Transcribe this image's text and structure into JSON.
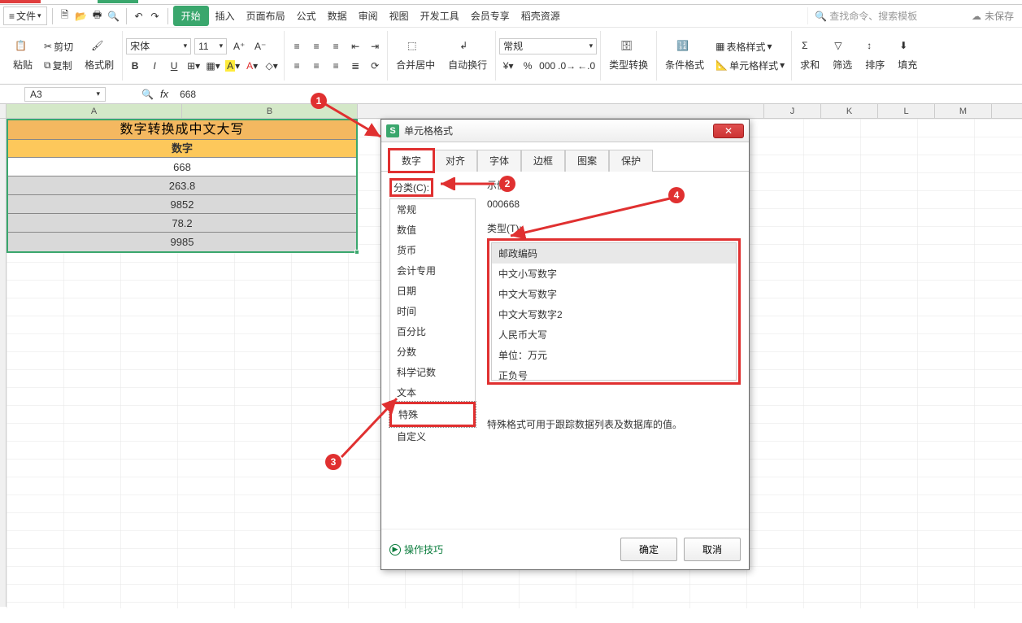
{
  "tabs": {
    "file": "文件"
  },
  "menu": {
    "start": "开始",
    "insert": "插入",
    "page": "页面布局",
    "formula": "公式",
    "data": "数据",
    "review": "审阅",
    "view": "视图",
    "dev": "开发工具",
    "vip": "会员专享",
    "daoke": "稻壳资源",
    "search_placeholder": "查找命令、搜索模板",
    "unsaved": "未保存"
  },
  "ribbon": {
    "cut": "剪切",
    "copy": "复制",
    "fmt_painter": "格式刷",
    "paste": "粘贴",
    "font_name": "宋体",
    "font_size": "11",
    "merge": "合并居中",
    "wrap": "自动换行",
    "general": "常规",
    "type_convert": "类型转换",
    "cond_fmt": "条件格式",
    "table_style": "表格样式",
    "cell_style": "单元格样式",
    "sum": "求和",
    "filter": "筛选",
    "sort": "排序",
    "fill": "填充"
  },
  "cell_bar": {
    "ref": "A3",
    "formula": "668"
  },
  "sheet": {
    "columns": [
      "A",
      "B",
      "J",
      "K",
      "L",
      "M"
    ],
    "title": "数字转换成中文大写",
    "header": "数字",
    "rows": [
      "668",
      "263.8",
      "9852",
      "78.2",
      "9985"
    ]
  },
  "dialog": {
    "title": "单元格格式",
    "tabs": [
      "数字",
      "对齐",
      "字体",
      "边框",
      "图案",
      "保护"
    ],
    "category_label": "分类(C):",
    "categories": [
      "常规",
      "数值",
      "货币",
      "会计专用",
      "日期",
      "时间",
      "百分比",
      "分数",
      "科学记数",
      "文本",
      "特殊",
      "自定义"
    ],
    "selected_category_index": 10,
    "sample_label": "示例",
    "sample_value": "000668",
    "type_label": "类型(T):",
    "types": [
      "邮政编码",
      "中文小写数字",
      "中文大写数字",
      "中文大写数字2",
      "人民币大写",
      "单位：万元",
      "正负号"
    ],
    "selected_type_index": 0,
    "description": "特殊格式可用于跟踪数据列表及数据库的值。",
    "tips": "操作技巧",
    "ok": "确定",
    "cancel": "取消"
  },
  "anno": {
    "n1": "1",
    "n2": "2",
    "n3": "3",
    "n4": "4"
  },
  "chart_data": {
    "type": "table",
    "title": "数字转换成中文大写",
    "columns": [
      "数字"
    ],
    "rows": [
      [
        668
      ],
      [
        263.8
      ],
      [
        9852
      ],
      [
        78.2
      ],
      [
        9985
      ]
    ]
  }
}
